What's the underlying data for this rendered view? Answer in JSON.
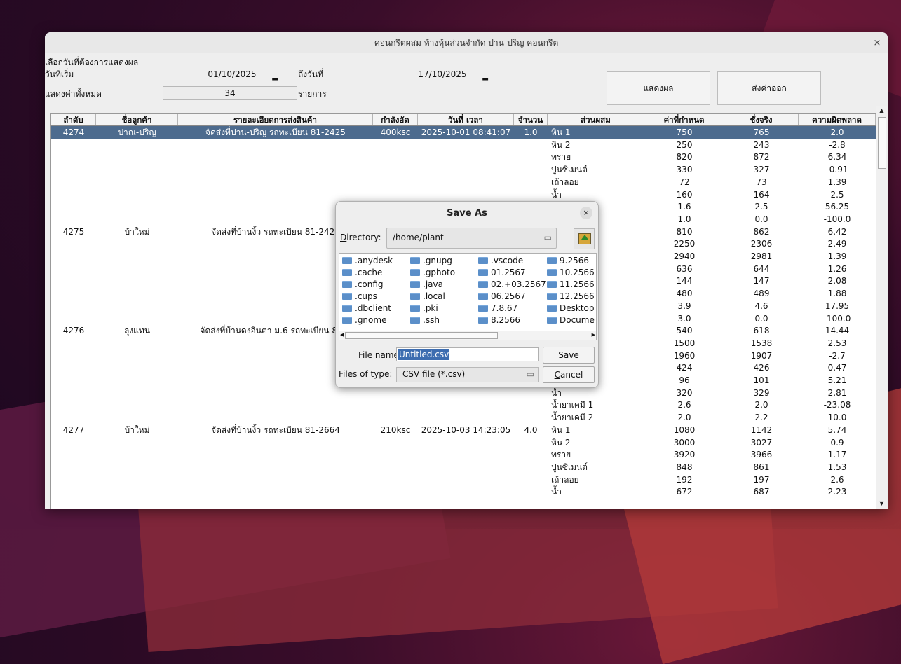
{
  "window": {
    "title": "คอนกรีตผสม ห้างหุ้นส่วนจำกัด ปาน-ปริญ คอนกรีต",
    "minimize": "–",
    "close": "×"
  },
  "filters": {
    "section_label": "เลือกวันที่ต้องการแสดงผล",
    "start_label": "วันที่เริ่ม",
    "start_date": "01/10/2025",
    "end_label": "ถึงวันที่",
    "end_date": "17/10/2025",
    "count_label": "แสดงค่าทั้งหมด",
    "count_value": "34",
    "count_unit": "รายการ",
    "show_button": "แสดงผล",
    "export_button": "ส่งค่าออก"
  },
  "table": {
    "headers": [
      "ลำดับ",
      "ชื่อลูกค้า",
      "รายละเอียดการส่งสินค้า",
      "กำลังอัด",
      "วันที่ เวลา",
      "จำนวน",
      "ส่วนผสม",
      "ค่าที่กำหนด",
      "ชั่งจริง",
      "ความผิดพลาด"
    ],
    "rows": [
      {
        "id": "4274",
        "customer": "ปาณ-ปริญ",
        "detail": "จัดส่งที่ปาน-ปริญ รถทะเบียน 81-2425",
        "strength": "400ksc",
        "datetime": "2025-10-01 08:41:07",
        "qty": "1.0",
        "mix": "หิน 1",
        "target": "750",
        "actual": "765",
        "error": "2.0"
      },
      {
        "id": "",
        "customer": "",
        "detail": "",
        "strength": "",
        "datetime": "",
        "qty": "",
        "mix": "หิน 2",
        "target": "250",
        "actual": "243",
        "error": "-2.8"
      },
      {
        "id": "",
        "customer": "",
        "detail": "",
        "strength": "",
        "datetime": "",
        "qty": "",
        "mix": "ทราย",
        "target": "820",
        "actual": "872",
        "error": "6.34"
      },
      {
        "id": "",
        "customer": "",
        "detail": "",
        "strength": "",
        "datetime": "",
        "qty": "",
        "mix": "ปูนซีเมนต์",
        "target": "330",
        "actual": "327",
        "error": "-0.91"
      },
      {
        "id": "",
        "customer": "",
        "detail": "",
        "strength": "",
        "datetime": "",
        "qty": "",
        "mix": "เถ้าลอย",
        "target": "72",
        "actual": "73",
        "error": "1.39"
      },
      {
        "id": "",
        "customer": "",
        "detail": "",
        "strength": "",
        "datetime": "",
        "qty": "",
        "mix": "น้ำ",
        "target": "160",
        "actual": "164",
        "error": "2.5"
      },
      {
        "id": "",
        "customer": "",
        "detail": "",
        "strength": "",
        "datetime": "",
        "qty": "",
        "mix": "",
        "target": "1.6",
        "actual": "2.5",
        "error": "56.25"
      },
      {
        "id": "",
        "customer": "",
        "detail": "",
        "strength": "",
        "datetime": "",
        "qty": "",
        "mix": "",
        "target": "1.0",
        "actual": "0.0",
        "error": "-100.0"
      },
      {
        "id": "4275",
        "customer": "บ้าใหม่",
        "detail": "จัดส่งที่บ้านงิ้ว รถทะเบียน 81-2425",
        "strength": "",
        "datetime": "",
        "qty": "",
        "mix": "",
        "target": "810",
        "actual": "862",
        "error": "6.42"
      },
      {
        "id": "",
        "customer": "",
        "detail": "",
        "strength": "",
        "datetime": "",
        "qty": "",
        "mix": "",
        "target": "2250",
        "actual": "2306",
        "error": "2.49"
      },
      {
        "id": "",
        "customer": "",
        "detail": "",
        "strength": "",
        "datetime": "",
        "qty": "",
        "mix": "",
        "target": "2940",
        "actual": "2981",
        "error": "1.39"
      },
      {
        "id": "",
        "customer": "",
        "detail": "",
        "strength": "",
        "datetime": "",
        "qty": "",
        "mix": "",
        "target": "636",
        "actual": "644",
        "error": "1.26"
      },
      {
        "id": "",
        "customer": "",
        "detail": "",
        "strength": "",
        "datetime": "",
        "qty": "",
        "mix": "",
        "target": "144",
        "actual": "147",
        "error": "2.08"
      },
      {
        "id": "",
        "customer": "",
        "detail": "",
        "strength": "",
        "datetime": "",
        "qty": "",
        "mix": "",
        "target": "480",
        "actual": "489",
        "error": "1.88"
      },
      {
        "id": "",
        "customer": "",
        "detail": "",
        "strength": "",
        "datetime": "",
        "qty": "",
        "mix": "",
        "target": "3.9",
        "actual": "4.6",
        "error": "17.95"
      },
      {
        "id": "",
        "customer": "",
        "detail": "",
        "strength": "",
        "datetime": "",
        "qty": "",
        "mix": "",
        "target": "3.0",
        "actual": "0.0",
        "error": "-100.0"
      },
      {
        "id": "4276",
        "customer": "ลุงแทน",
        "detail": "จัดส่งที่บ้านดงอินตา ม.6 รถทะเบียน 81-2",
        "strength": "",
        "datetime": "",
        "qty": "",
        "mix": "",
        "target": "540",
        "actual": "618",
        "error": "14.44"
      },
      {
        "id": "",
        "customer": "",
        "detail": "",
        "strength": "",
        "datetime": "",
        "qty": "",
        "mix": "",
        "target": "1500",
        "actual": "1538",
        "error": "2.53"
      },
      {
        "id": "",
        "customer": "",
        "detail": "",
        "strength": "",
        "datetime": "",
        "qty": "",
        "mix": "",
        "target": "1960",
        "actual": "1907",
        "error": "-2.7"
      },
      {
        "id": "",
        "customer": "",
        "detail": "",
        "strength": "",
        "datetime": "",
        "qty": "",
        "mix": "",
        "target": "424",
        "actual": "426",
        "error": "0.47"
      },
      {
        "id": "",
        "customer": "",
        "detail": "",
        "strength": "",
        "datetime": "",
        "qty": "",
        "mix": "",
        "target": "96",
        "actual": "101",
        "error": "5.21"
      },
      {
        "id": "",
        "customer": "",
        "detail": "",
        "strength": "",
        "datetime": "",
        "qty": "",
        "mix": "น้ำ",
        "target": "320",
        "actual": "329",
        "error": "2.81"
      },
      {
        "id": "",
        "customer": "",
        "detail": "",
        "strength": "",
        "datetime": "",
        "qty": "",
        "mix": "น้ำยาเคมี 1",
        "target": "2.6",
        "actual": "2.0",
        "error": "-23.08"
      },
      {
        "id": "",
        "customer": "",
        "detail": "",
        "strength": "",
        "datetime": "",
        "qty": "",
        "mix": "น้ำยาเคมี 2",
        "target": "2.0",
        "actual": "2.2",
        "error": "10.0"
      },
      {
        "id": "4277",
        "customer": "บ้าใหม่",
        "detail": "จัดส่งที่บ้านงิ้ว รถทะเบียน 81-2664",
        "strength": "210ksc",
        "datetime": "2025-10-03 14:23:05",
        "qty": "4.0",
        "mix": "หิน 1",
        "target": "1080",
        "actual": "1142",
        "error": "5.74"
      },
      {
        "id": "",
        "customer": "",
        "detail": "",
        "strength": "",
        "datetime": "",
        "qty": "",
        "mix": "หิน 2",
        "target": "3000",
        "actual": "3027",
        "error": "0.9"
      },
      {
        "id": "",
        "customer": "",
        "detail": "",
        "strength": "",
        "datetime": "",
        "qty": "",
        "mix": "ทราย",
        "target": "3920",
        "actual": "3966",
        "error": "1.17"
      },
      {
        "id": "",
        "customer": "",
        "detail": "",
        "strength": "",
        "datetime": "",
        "qty": "",
        "mix": "ปูนซีเมนต์",
        "target": "848",
        "actual": "861",
        "error": "1.53"
      },
      {
        "id": "",
        "customer": "",
        "detail": "",
        "strength": "",
        "datetime": "",
        "qty": "",
        "mix": "เถ้าลอย",
        "target": "192",
        "actual": "197",
        "error": "2.6"
      },
      {
        "id": "",
        "customer": "",
        "detail": "",
        "strength": "",
        "datetime": "",
        "qty": "",
        "mix": "น้ำ",
        "target": "672",
        "actual": "687",
        "error": "2.23"
      }
    ]
  },
  "dialog": {
    "title": "Save As",
    "close": "×",
    "directory_label_u": "D",
    "directory_label_rest": "irectory:",
    "directory_value": "/home/plant",
    "combo_arrow": "▭",
    "files": [
      ".anydesk",
      ".cache",
      ".config",
      ".cups",
      ".dbclient",
      ".gnome",
      ".gnupg",
      ".gphoto",
      ".java",
      ".local",
      ".pki",
      ".ssh",
      ".vscode",
      "01.2567",
      "02.+03.2567",
      "06.2567",
      "7.8.67",
      "8.2566",
      "9.2566",
      "10.2566",
      "11.2566",
      "12.2566",
      "Desktop",
      "Docume"
    ],
    "filename_label_a": "File ",
    "filename_label_u": "n",
    "filename_label_b": "ame:",
    "filename_value": "Untitled.csv",
    "filetype_label_a": "Files of ",
    "filetype_label_u": "t",
    "filetype_label_b": "ype:",
    "filetype_value": "CSV file (*.csv)",
    "save_u": "S",
    "save_rest": "ave",
    "cancel_u": "C",
    "cancel_rest": "ancel",
    "icon_folder": "folder-icon",
    "icon_up": "up-folder-icon"
  },
  "colors": {
    "selection": "#4d6b8e",
    "filename_highlight": "#3d6db0",
    "folder": "#5b8fc9"
  }
}
